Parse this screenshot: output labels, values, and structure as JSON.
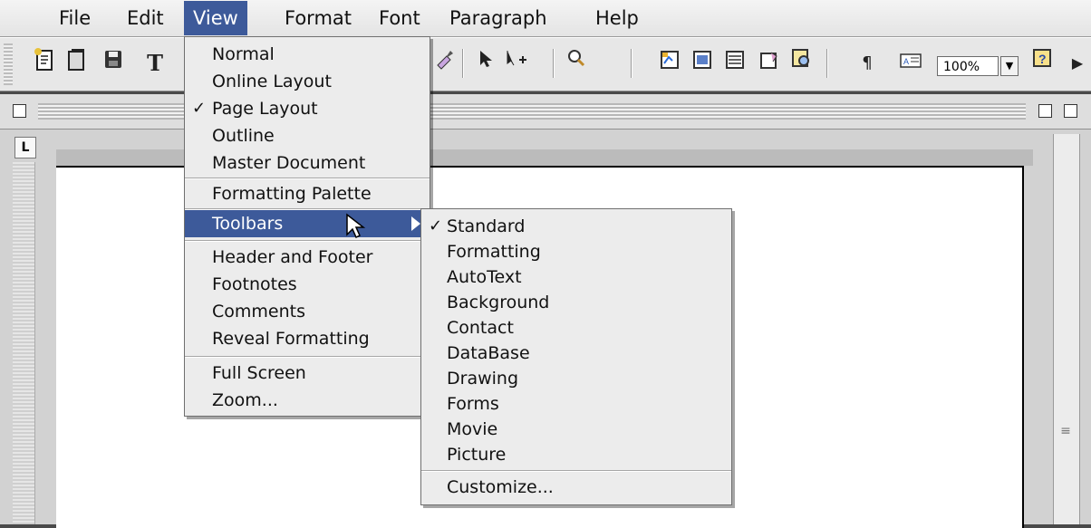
{
  "menubar": {
    "items": [
      "File",
      "Edit",
      "View",
      "Format",
      "Font",
      "Paragraph",
      "Help"
    ],
    "active": "View"
  },
  "toolbar": {
    "icons": [
      "new-document-icon",
      "open-icon",
      "save-icon",
      "text-icon",
      "format-painter-icon",
      "pointer-icon",
      "move-icon",
      "zoom-icon",
      "table-icon",
      "columns-icon",
      "lines-icon",
      "chart-icon",
      "find-icon",
      "paragraph-mark-icon",
      "text-box-icon",
      "help-icon",
      "more-icon"
    ],
    "zoom_value": "100%"
  },
  "view_menu": {
    "items": [
      {
        "label": "Normal",
        "checked": false
      },
      {
        "label": "Online Layout",
        "checked": false
      },
      {
        "label": "Page Layout",
        "checked": true
      },
      {
        "label": "Outline",
        "checked": false
      },
      {
        "label": "Master Document",
        "checked": false
      },
      {
        "label": "Formatting Palette",
        "checked": false
      },
      {
        "label": "Toolbars",
        "checked": false,
        "submenu": true,
        "highlighted": true
      },
      {
        "label": "Header and Footer",
        "checked": false
      },
      {
        "label": "Footnotes",
        "checked": false
      },
      {
        "label": "Comments",
        "checked": false
      },
      {
        "label": "Reveal Formatting",
        "checked": false
      },
      {
        "label": "Full Screen",
        "checked": false
      },
      {
        "label": "Zoom...",
        "checked": false
      }
    ],
    "check_mark": "✓"
  },
  "toolbars_submenu": {
    "items": [
      {
        "label": "Standard",
        "checked": true
      },
      {
        "label": "Formatting",
        "checked": false
      },
      {
        "label": "AutoText",
        "checked": false
      },
      {
        "label": "Background",
        "checked": false
      },
      {
        "label": "Contact",
        "checked": false
      },
      {
        "label": "DataBase",
        "checked": false
      },
      {
        "label": "Drawing",
        "checked": false
      },
      {
        "label": "Forms",
        "checked": false
      },
      {
        "label": "Movie",
        "checked": false
      },
      {
        "label": "Picture",
        "checked": false
      },
      {
        "label": "Customize...",
        "checked": false
      }
    ],
    "check_mark": "✓"
  },
  "ruler": {
    "tab_glyph": "L"
  },
  "colors": {
    "highlight": "#3d5a9a",
    "menu_bg": "#ececec",
    "backdrop": "#4a4a4a"
  }
}
